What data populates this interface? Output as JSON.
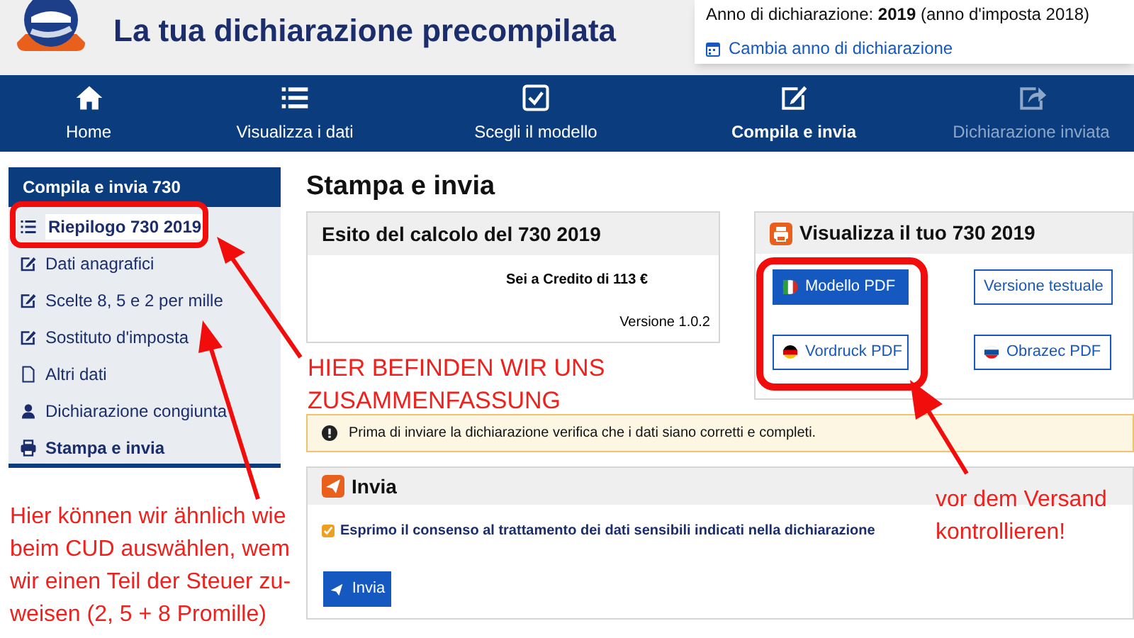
{
  "header": {
    "title": "La tua dichiarazione precompilata",
    "year_info": "Anno di dichiarazione: **2019** (anno d'imposta 2018)",
    "change_year_link": "Cambia anno di dichiarazione"
  },
  "nav": [
    {
      "label": "Home",
      "selected": false,
      "disabled": false
    },
    {
      "label": "Visualizza i dati",
      "selected": false,
      "disabled": false
    },
    {
      "label": "Scegli il modello",
      "selected": false,
      "disabled": false
    },
    {
      "label": "Compila e invia",
      "selected": true,
      "disabled": false
    },
    {
      "label": "Dichiarazione inviata",
      "selected": false,
      "disabled": true
    }
  ],
  "sidebar": {
    "title": "Compila e invia 730",
    "items": [
      {
        "label": "Riepilogo 730 2019",
        "active": true
      },
      {
        "label": "Dati anagrafici",
        "active": false
      },
      {
        "label": "Scelte 8, 5 e 2 per mille",
        "active": false
      },
      {
        "label": "Sostituto d'imposta",
        "active": false
      },
      {
        "label": "Altri dati",
        "active": false
      },
      {
        "label": "Dichiarazione congiunta",
        "active": false
      },
      {
        "label": "Stampa e invia",
        "active": true
      }
    ]
  },
  "page_title": "Stampa e invia",
  "result_card": {
    "title": "Esito del calcolo del 730 2019",
    "result": "Sei a Credito di 113 €",
    "version": "Versione 1.0.2"
  },
  "view_card": {
    "title": "Visualizza il tuo 730 2019",
    "buttons": [
      {
        "label": "Modello PDF",
        "selected": true
      },
      {
        "label": "Versione testuale",
        "selected": false
      },
      {
        "label": "Vordruck PDF",
        "selected": false
      },
      {
        "label": "Obrazec PDF",
        "selected": false
      }
    ]
  },
  "warning": "Prima di inviare la dichiarazione verifica che i dati siano corretti e completi.",
  "send_card": {
    "title": "Invia",
    "consent": "Esprimo il consenso al trattamento dei dati sensibili indicati nella dichiarazione",
    "consent_checked": true,
    "button": "Invia"
  },
  "annotations": [
    {
      "text": "HIER BEFINDEN WIR UNS\nZUSAMMENFASSUNG"
    },
    {
      "text": "Hier können wir ähnlich wie\nbeim CUD auswählen, wem\nwir einen Teil der Steuer zu-\nweisen (2, 5 + 8 Promille)"
    },
    {
      "text": "vor dem Versand\nkontrollieren!"
    }
  ]
}
